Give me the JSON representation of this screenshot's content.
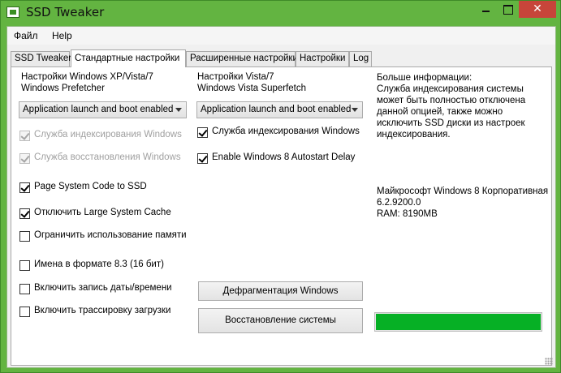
{
  "window": {
    "title": "SSD Tweaker",
    "close_glyph": "✕",
    "accent": "#63b441"
  },
  "menu": {
    "file": "Файл",
    "help": "Help"
  },
  "tabs": [
    {
      "label": "SSD Tweaker"
    },
    {
      "label": "Стандартные настройки"
    },
    {
      "label": "Расширенные настройки"
    },
    {
      "label": "Настройки"
    },
    {
      "label": "Log"
    }
  ],
  "left": {
    "heading_line1": "Настройки Windows XP/Vista/7",
    "heading_line2": "Windows Prefetcher",
    "combo_value": "Application launch and boot enabled",
    "options": [
      {
        "label": "Служба индексирования Windows",
        "checked": true,
        "disabled": true
      },
      {
        "label": "Служба восстановления Windows",
        "checked": true,
        "disabled": true
      },
      {
        "label": "Page System Code to SSD",
        "checked": true,
        "disabled": false
      },
      {
        "label": "Отключить Large System Cache",
        "checked": true,
        "disabled": false
      },
      {
        "label": "Ограничить использование памяти",
        "checked": false,
        "disabled": false
      },
      {
        "label": "Имена в формате 8.3 (16 бит)",
        "checked": false,
        "disabled": false
      },
      {
        "label": "Включить запись даты/времени",
        "checked": false,
        "disabled": false
      },
      {
        "label": "Включить трассировку загрузки",
        "checked": false,
        "disabled": false
      }
    ]
  },
  "middle": {
    "heading_line1": "Настройки Vista/7",
    "heading_line2": "Windows Vista Superfetch",
    "combo_value": "Application launch and boot enabled",
    "options": [
      {
        "label": "Служба индексирования Windows",
        "checked": true
      },
      {
        "label": "Enable Windows 8 Autostart Delay",
        "checked": true
      }
    ],
    "defrag_button": "Дефрагментация Windows",
    "restore_button": "Восстановление системы"
  },
  "right": {
    "more_info_title": "Больше информации:",
    "info_line1": "Служба индексирования системы",
    "info_line2": "может быть полностью отключена",
    "info_line3": "данной опцией, также можно",
    "info_line4": "исключить SSD диски из настроек",
    "info_line5": "индексирования.",
    "os_name": "Майкрософт Windows 8 Корпоративная",
    "os_version": "6.2.9200.0",
    "ram": "RAM: 8190MB",
    "progress_fraction": 1.0,
    "progress_color": "#06b025"
  }
}
